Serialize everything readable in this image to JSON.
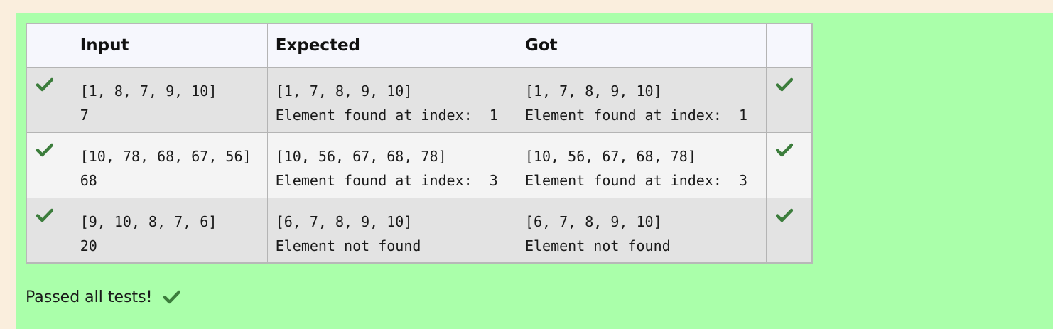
{
  "colors": {
    "page_background": "#faeedd",
    "result_panel_background": "#aaffaa",
    "check_green": "#3c7d3c"
  },
  "results_table": {
    "headers": {
      "status": "",
      "input": "Input",
      "expected": "Expected",
      "got": "Got",
      "mark": ""
    },
    "rows": [
      {
        "status_icon": "check-icon",
        "input": [
          "[1, 8, 7, 9, 10]",
          "7"
        ],
        "expected": [
          "[1, 7, 8, 9, 10]",
          "Element found at index:  1"
        ],
        "got": [
          "[1, 7, 8, 9, 10]",
          "Element found at index:  1"
        ],
        "mark_icon": "check-icon"
      },
      {
        "status_icon": "check-icon",
        "input": [
          "[10, 78, 68, 67, 56]",
          "68"
        ],
        "expected": [
          "[10, 56, 67, 68, 78]",
          "Element found at index:  3"
        ],
        "got": [
          "[10, 56, 67, 68, 78]",
          "Element found at index:  3"
        ],
        "mark_icon": "check-icon"
      },
      {
        "status_icon": "check-icon",
        "input": [
          "[9, 10, 8, 7, 6]",
          "20"
        ],
        "expected": [
          "[6, 7, 8, 9, 10]",
          "Element not found"
        ],
        "got": [
          "[6, 7, 8, 9, 10]",
          "Element not found"
        ],
        "mark_icon": "check-icon"
      }
    ]
  },
  "summary": {
    "text": "Passed all tests!",
    "icon": "check-icon"
  }
}
